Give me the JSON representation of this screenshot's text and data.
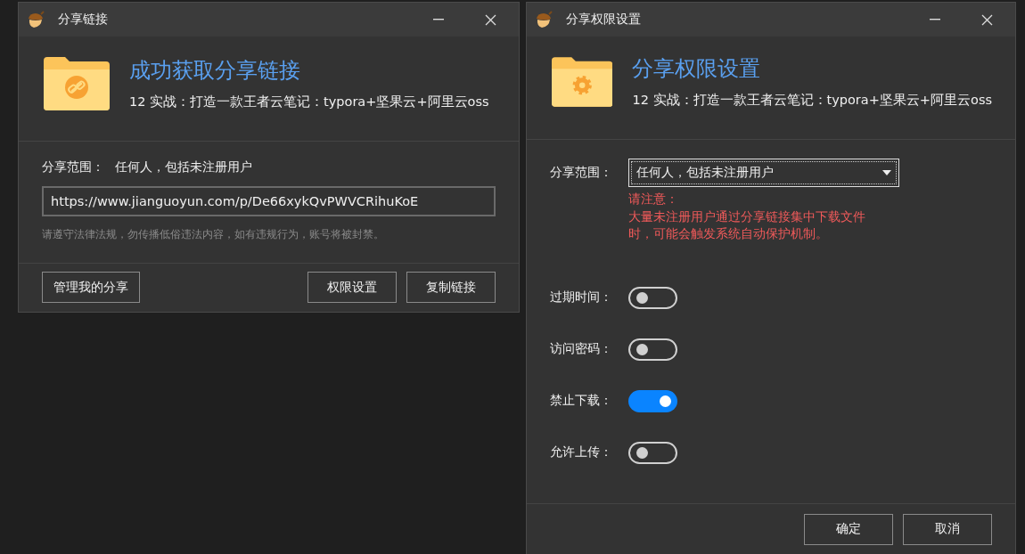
{
  "share_link_window": {
    "title": "分享链接",
    "heading": "成功获取分享链接",
    "subtitle": "12 实战：打造一款王者云笔记：typora+坚果云+阿里云oss",
    "scope_label": "分享范围：",
    "scope_value": "任何人，包括未注册用户",
    "link": "https://www.jianguoyun.com/p/De66xykQvPWVCRihuKoE",
    "notice": "请遵守法律法规，勿传播低俗违法内容，如有违规行为，账号将被封禁。",
    "buttons": [
      {
        "label": "管理我的分享",
        "kind": "left"
      },
      {
        "label": "权限设置",
        "kind": "right"
      },
      {
        "label": "复制链接",
        "kind": "right"
      }
    ]
  },
  "permission_window": {
    "title": "分享权限设置",
    "heading": "分享权限设置",
    "subtitle": "12 实战：打造一款王者云笔记：typora+坚果云+阿里云oss",
    "scope_label": "分享范围：",
    "scope_value": "任何人，包括未注册用户",
    "warning": [
      "请注意：",
      "大量未注册用户通过分享链接集中下载文件",
      "时，可能会触发系统自动保护机制。"
    ],
    "options": [
      {
        "label": "过期时间：",
        "on": false
      },
      {
        "label": "访问密码：",
        "on": false
      },
      {
        "label": "禁止下载：",
        "on": true
      },
      {
        "label": "允许上传：",
        "on": false
      }
    ],
    "buttons": [
      "确定",
      "取消"
    ]
  }
}
